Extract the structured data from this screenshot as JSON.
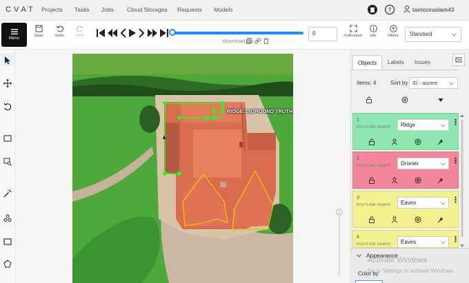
{
  "app": {
    "logo": "CVAT",
    "nav": [
      "Projects",
      "Tasks",
      "Jobs",
      "Cloud Storages",
      "Requests",
      "Models"
    ],
    "username": "taimooraslam43"
  },
  "toolbar": {
    "menu_label": "Menu",
    "save_label": "Save",
    "undo_label": "Undo",
    "redo_label": "Redo",
    "filename": "download.jpg",
    "frame_value": "0",
    "fullscreen_label": "Fullscreen",
    "info_label": "Info",
    "filters_label": "Filters",
    "workspace_value": "Standard"
  },
  "canvas": {
    "annotation_label": "RIDGE 1 (GROUND TRUTH)",
    "accent": "#1aff1a"
  },
  "sidebar": {
    "tabs": [
      "Objects",
      "Labels",
      "Issues"
    ],
    "items_label": "Items: 4",
    "sort_label": "Sort by",
    "sort_value": "ID - ascent",
    "objects": [
      {
        "id": "1",
        "shape": "POLYLINE SHAPE",
        "label": "Ridge",
        "color": "#8ee6b0"
      },
      {
        "id": "2",
        "shape": "POLYLINE SHAPE",
        "label": "Dronier",
        "color": "#f2879a"
      },
      {
        "id": "3",
        "shape": "POLYLINE SHAPE",
        "label": "Eaves",
        "color": "#f4f28f"
      },
      {
        "id": "4",
        "shape": "POLYLINE SHAPE",
        "label": "Eaves",
        "color": "#f4f28f"
      }
    ],
    "appearance_label": "Appearance",
    "color_by_label": "Color by"
  },
  "watermark": {
    "line1": "Activate Windows",
    "line2": "Go to Settings to activate Windows."
  }
}
